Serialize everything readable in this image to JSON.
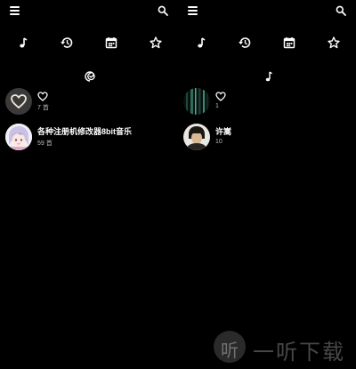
{
  "colors": {
    "background": "#000000",
    "foreground": "#ffffff",
    "secondary_text": "#bbbbbb"
  },
  "toolbar_icons": [
    "menu-icon",
    "search-icon"
  ],
  "tab_icons": [
    "music-note-icon",
    "history-icon",
    "calendar-icon",
    "star-icon"
  ],
  "left_screen": {
    "sub_icon": "spiral-icon",
    "items": [
      {
        "icon": "heart-outline-icon",
        "count": "7 首",
        "thumb": "heart-thumbnail"
      },
      {
        "title": "各种注册机修改器8bit音乐",
        "count": "59 首",
        "thumb": "anime-avatar"
      }
    ]
  },
  "right_screen": {
    "sub_icon": "music-note-icon",
    "items": [
      {
        "icon": "heart-outline-icon",
        "count": "1",
        "thumb": "dark-green-thumbnail"
      },
      {
        "title": "许嵩",
        "count": "10",
        "thumb": "artist-photo"
      }
    ]
  },
  "watermark": {
    "logo_glyph": "听",
    "text": "一听下载"
  }
}
